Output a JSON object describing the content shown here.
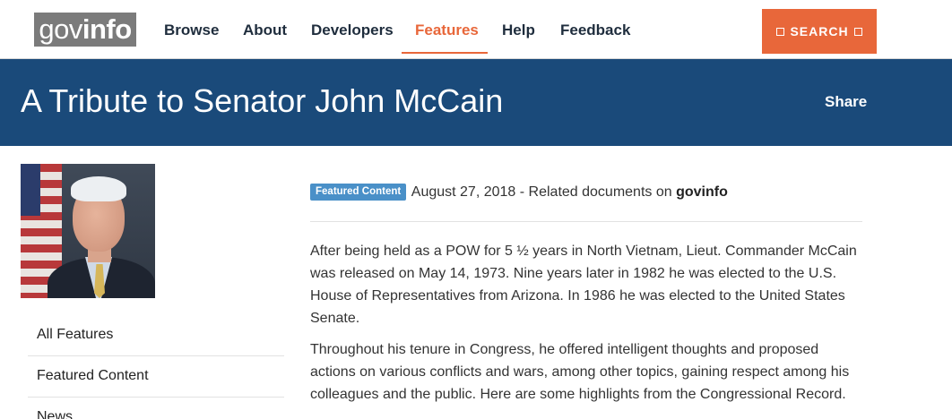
{
  "logo": {
    "part1": "gov",
    "part2": "info"
  },
  "nav": {
    "browse": "Browse",
    "about": "About",
    "developers": "Developers",
    "features": "Features",
    "help": "Help",
    "feedback": "Feedback",
    "active": "Features"
  },
  "search": {
    "label": "SEARCH"
  },
  "banner": {
    "title": "A Tribute to Senator John McCain",
    "share": "Share"
  },
  "sidebar": {
    "items": [
      {
        "label": "All Features"
      },
      {
        "label": "Featured Content"
      },
      {
        "label": "News"
      }
    ]
  },
  "article": {
    "badge": "Featured Content",
    "date": "August 27, 2018",
    "meta_text": " - Related documents on ",
    "meta_link": "govinfo",
    "paragraphs": [
      "After being held as a POW for 5 ½ years in North Vietnam, Lieut. Commander McCain was released on May 14, 1973. Nine years later in 1982 he was elected to the U.S. House of Representatives from Arizona. In 1986 he was elected to the United States Senate.",
      "Throughout his tenure in Congress, he offered intelligent thoughts and proposed actions on various conflicts and wars, among other topics, gaining respect among his colleagues and the public. Here are some highlights from the Congressional Record."
    ]
  },
  "colors": {
    "accent": "#e8673a",
    "banner": "#1a4a7a",
    "badge": "#4a90c8",
    "nav_text": "#1f2d3d"
  },
  "icons": {
    "search_left": "square-icon",
    "search_right": "square-icon"
  }
}
